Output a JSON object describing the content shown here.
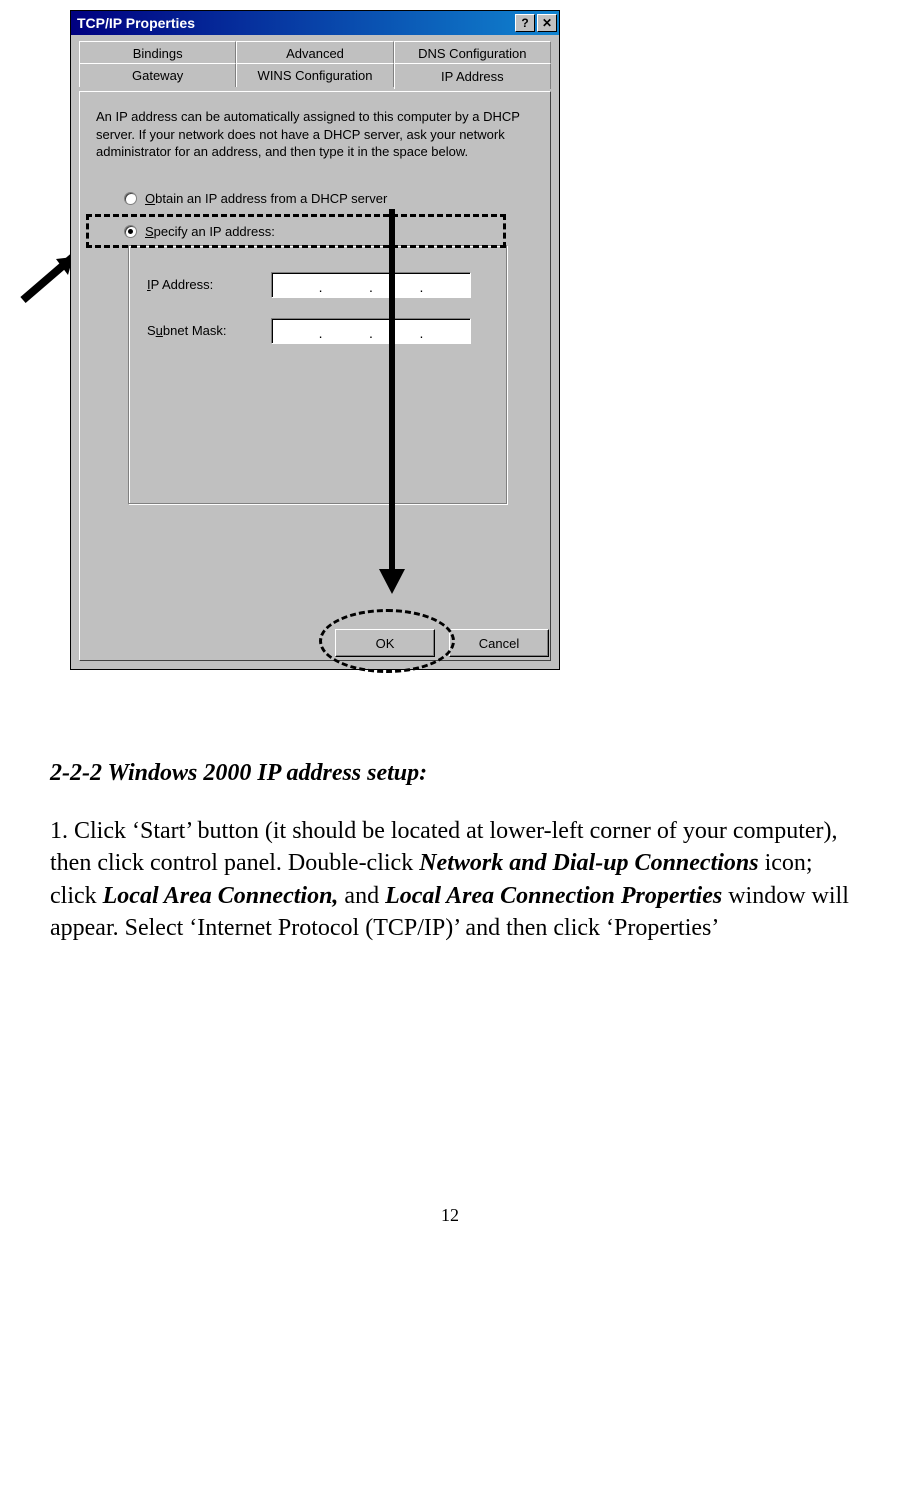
{
  "dialog": {
    "title": "TCP/IP Properties",
    "help_glyph": "?",
    "close_glyph": "✕",
    "tabs": {
      "bindings": "Bindings",
      "advanced": "Advanced",
      "dns": "DNS Configuration",
      "gateway": "Gateway",
      "wins": "WINS Configuration",
      "ip": "IP Address"
    },
    "help_text": "An IP address can be automatically assigned to this computer by a DHCP server. If your network does not have a DHCP server, ask your network administrator for an address, and then type it in the space below.",
    "radio_obtain_pre": "O",
    "radio_obtain_post": "btain an IP address from a DHCP server",
    "radio_specify_pre": "S",
    "radio_specify_post": "pecify an IP address:",
    "ip_label_pre": "I",
    "ip_label_post": "P Address:",
    "subnet_label_pre": "S",
    "subnet_label_mid": "u",
    "subnet_label_post": "bnet Mask:",
    "ip_dots": "·    ·    ·",
    "subnet_dots": "·    ·    ·",
    "ok": "OK",
    "cancel": "Cancel"
  },
  "doc": {
    "heading": "2-2-2 Windows 2000 IP address setup:",
    "para_pre": "1. Click ‘Start’ button (it should be located at lower-left corner of your computer), then click control panel. Double-click ",
    "bold1": "Network and Dial-up Connections",
    "mid1": " icon; click ",
    "bold2": "Local Area Connection,",
    "mid2": " and ",
    "bold3": "Local Area Connection Properties",
    "mid3": " window will appear. Select ‘Internet Protocol (TCP/IP)’ and then click ‘Properties’",
    "page_number": "12"
  }
}
